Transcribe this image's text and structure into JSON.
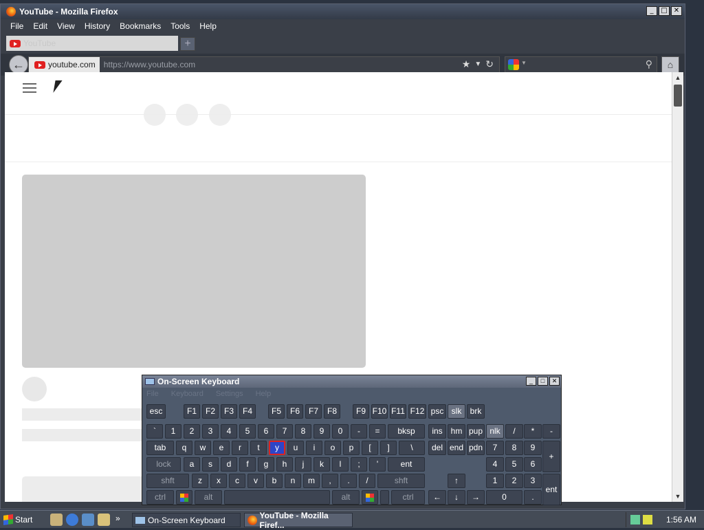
{
  "firefox": {
    "title": "YouTube - Mozilla Firefox",
    "menu": [
      "File",
      "Edit",
      "View",
      "History",
      "Bookmarks",
      "Tools",
      "Help"
    ],
    "tab_title": "YouTube",
    "new_tab_symbol": "+",
    "identity": "youtube.com",
    "url": "https://www.youtube.com",
    "search_placeholder": "",
    "window_buttons": [
      "_",
      "□",
      "✕"
    ]
  },
  "osk": {
    "title": "On-Screen Keyboard",
    "menu": [
      "File",
      "Keyboard",
      "Settings",
      "Help"
    ],
    "selected_key": "y",
    "keys": {
      "esc": "esc",
      "f1": "F1",
      "f2": "F2",
      "f3": "F3",
      "f4": "F4",
      "f5": "F5",
      "f6": "F6",
      "f7": "F7",
      "f8": "F8",
      "f9": "F9",
      "f10": "F10",
      "f11": "F11",
      "f12": "F12",
      "psc": "psc",
      "slk": "slk",
      "brk": "brk",
      "grave": "`",
      "n1": "1",
      "n2": "2",
      "n3": "3",
      "n4": "4",
      "n5": "5",
      "n6": "6",
      "n7": "7",
      "n8": "8",
      "n9": "9",
      "n0": "0",
      "minus": "-",
      "equal": "=",
      "bksp": "bksp",
      "ins": "ins",
      "hm": "hm",
      "pup": "pup",
      "nlk": "nlk",
      "kdiv": "/",
      "kmul": "*",
      "kminus": "-",
      "tab": "tab",
      "q": "q",
      "w": "w",
      "e": "e",
      "r": "r",
      "t": "t",
      "y": "y",
      "u": "u",
      "i": "i",
      "o": "o",
      "p": "p",
      "lbr": "[",
      "rbr": "]",
      "bsl": "\\",
      "del": "del",
      "end": "end",
      "pdn": "pdn",
      "k7": "7",
      "k8": "8",
      "k9": "9",
      "kplus": "+",
      "lock": "lock",
      "a": "a",
      "s": "s",
      "d": "d",
      "f": "f",
      "g": "g",
      "h": "h",
      "j": "j",
      "k": "k",
      "l": "l",
      "semi": ";",
      "quote": "'",
      "ent": "ent",
      "k4": "4",
      "k5": "5",
      "k6": "6",
      "lshft": "shft",
      "z": "z",
      "x": "x",
      "c": "c",
      "v": "v",
      "b": "b",
      "n": "n",
      "m": "m",
      "comma": ",",
      "dot": ".",
      "slash": "/",
      "rshft": "shft",
      "up": "↑",
      "k1": "1",
      "k2": "2",
      "k3": "3",
      "kent": "ent",
      "lctrl": "ctrl",
      "lalt": "alt",
      "ralt": "alt",
      "rctrl": "ctrl",
      "left": "←",
      "down": "↓",
      "right": "→",
      "k0": "0",
      "kdot": "."
    }
  },
  "taskbar": {
    "start": "Start",
    "more": "»",
    "items": [
      "On-Screen Keyboard",
      "YouTube - Mozilla Firef..."
    ],
    "clock": "1:56 AM"
  }
}
